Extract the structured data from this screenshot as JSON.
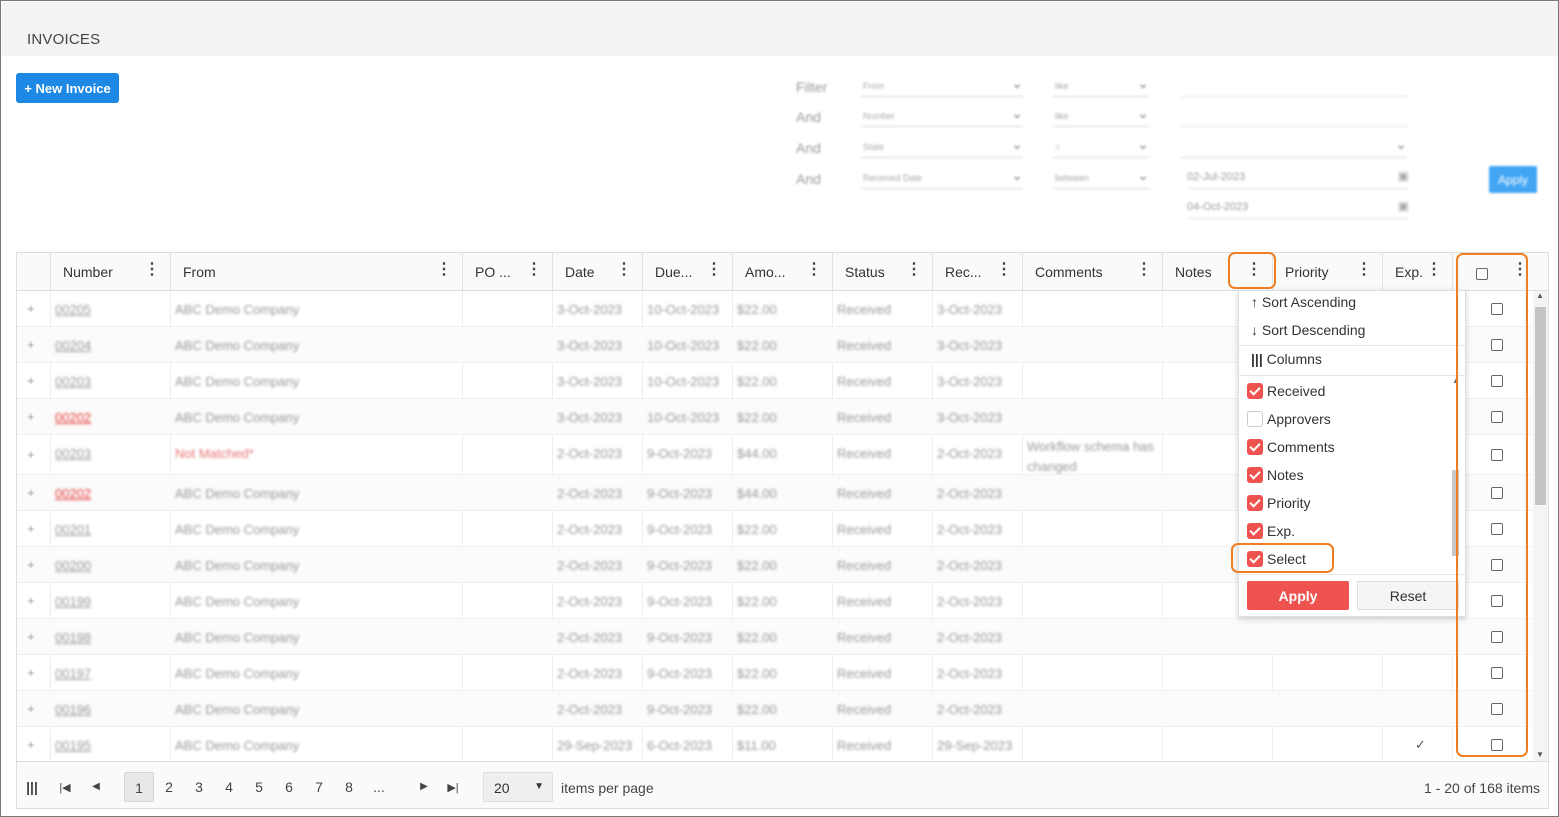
{
  "page": {
    "title": "INVOICES",
    "new_button": "+ New Invoice"
  },
  "filters": {
    "rows": [
      {
        "label": "Filter",
        "field": "From",
        "operator": "like",
        "value": ""
      },
      {
        "label": "And",
        "field": "Number",
        "operator": "like",
        "value": ""
      },
      {
        "label": "And",
        "field": "State",
        "operator": "=",
        "value": ""
      },
      {
        "label": "And",
        "field": "Received Date",
        "operator": "between",
        "value": "02-Jul-2023",
        "value2": "04-Oct-2023"
      }
    ],
    "apply": "Apply"
  },
  "grid": {
    "columns": [
      "Number",
      "From",
      "PO ...",
      "Date",
      "Due...",
      "Amo...",
      "Status",
      "Rec...",
      "Comments",
      "Notes",
      "Priority",
      "Exp."
    ],
    "rows": [
      {
        "number": "00205",
        "from": "ABC Demo Company",
        "date": "3-Oct-2023",
        "due": "10-Oct-2023",
        "amount": "$22.00",
        "status": "Received",
        "rec": "3-Oct-2023",
        "comments": "",
        "exp": ""
      },
      {
        "number": "00204",
        "from": "ABC Demo Company",
        "date": "3-Oct-2023",
        "due": "10-Oct-2023",
        "amount": "$22.00",
        "status": "Received",
        "rec": "3-Oct-2023",
        "comments": "",
        "exp": ""
      },
      {
        "number": "00203",
        "from": "ABC Demo Company",
        "date": "3-Oct-2023",
        "due": "10-Oct-2023",
        "amount": "$22.00",
        "status": "Received",
        "rec": "3-Oct-2023",
        "comments": "",
        "exp": ""
      },
      {
        "number": "00202",
        "from": "ABC Demo Company",
        "date": "3-Oct-2023",
        "due": "10-Oct-2023",
        "amount": "$22.00",
        "status": "Received",
        "rec": "3-Oct-2023",
        "comments": "",
        "exp": "",
        "flag": "red"
      },
      {
        "number": "00203",
        "from": "Not Matched*",
        "date": "2-Oct-2023",
        "due": "9-Oct-2023",
        "amount": "$44.00",
        "status": "Received",
        "rec": "2-Oct-2023",
        "comments": "Workflow schema has changed",
        "exp": "",
        "from_flag": "red"
      },
      {
        "number": "00202",
        "from": "ABC Demo Company",
        "date": "2-Oct-2023",
        "due": "9-Oct-2023",
        "amount": "$44.00",
        "status": "Received",
        "rec": "2-Oct-2023",
        "comments": "",
        "exp": "",
        "flag": "red"
      },
      {
        "number": "00201",
        "from": "ABC Demo Company",
        "date": "2-Oct-2023",
        "due": "9-Oct-2023",
        "amount": "$22.00",
        "status": "Received",
        "rec": "2-Oct-2023",
        "comments": "",
        "exp": ""
      },
      {
        "number": "00200",
        "from": "ABC Demo Company",
        "date": "2-Oct-2023",
        "due": "9-Oct-2023",
        "amount": "$22.00",
        "status": "Received",
        "rec": "2-Oct-2023",
        "comments": "",
        "exp": ""
      },
      {
        "number": "00199",
        "from": "ABC Demo Company",
        "date": "2-Oct-2023",
        "due": "9-Oct-2023",
        "amount": "$22.00",
        "status": "Received",
        "rec": "2-Oct-2023",
        "comments": "",
        "exp": ""
      },
      {
        "number": "00198",
        "from": "ABC Demo Company",
        "date": "2-Oct-2023",
        "due": "9-Oct-2023",
        "amount": "$22.00",
        "status": "Received",
        "rec": "2-Oct-2023",
        "comments": "",
        "exp": ""
      },
      {
        "number": "00197",
        "from": "ABC Demo Company",
        "date": "2-Oct-2023",
        "due": "9-Oct-2023",
        "amount": "$22.00",
        "status": "Received",
        "rec": "2-Oct-2023",
        "comments": "",
        "exp": ""
      },
      {
        "number": "00196",
        "from": "ABC Demo Company",
        "date": "2-Oct-2023",
        "due": "9-Oct-2023",
        "amount": "$22.00",
        "status": "Received",
        "rec": "2-Oct-2023",
        "comments": "",
        "exp": ""
      },
      {
        "number": "00195",
        "from": "ABC Demo Company",
        "date": "29-Sep-2023",
        "due": "6-Oct-2023",
        "amount": "$11.00",
        "status": "Received",
        "rec": "29-Sep-2023",
        "comments": "",
        "exp": "✓"
      }
    ]
  },
  "column_menu": {
    "sort_asc": "Sort Ascending",
    "sort_desc": "Sort Descending",
    "columns_label": "Columns",
    "items": [
      {
        "label": "Received",
        "checked": true
      },
      {
        "label": "Approvers",
        "checked": false
      },
      {
        "label": "Comments",
        "checked": true
      },
      {
        "label": "Notes",
        "checked": true
      },
      {
        "label": "Priority",
        "checked": true
      },
      {
        "label": "Exp.",
        "checked": true
      },
      {
        "label": "Select",
        "checked": true
      }
    ],
    "apply": "Apply",
    "reset": "Reset"
  },
  "pager": {
    "pages": [
      "1",
      "2",
      "3",
      "4",
      "5",
      "6",
      "7",
      "8",
      "..."
    ],
    "current": "1",
    "page_size": "20",
    "items_per_page": "items per page",
    "info": "1 - 20 of 168 items"
  },
  "colors": {
    "accent": "#1e88e5",
    "menu_accent": "#ef5350",
    "highlight": "#ef7d22"
  }
}
